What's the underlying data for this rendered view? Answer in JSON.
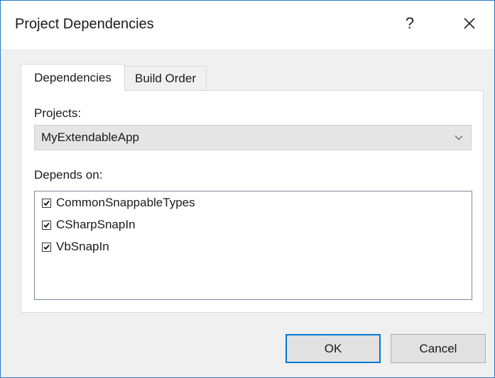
{
  "window": {
    "title": "Project Dependencies",
    "help_label": "?",
    "close_icon": "close-icon"
  },
  "tabs": [
    {
      "label": "Dependencies",
      "selected": true
    },
    {
      "label": "Build Order",
      "selected": false
    }
  ],
  "projects": {
    "label": "Projects:",
    "selected": "MyExtendableApp"
  },
  "depends_on": {
    "label": "Depends on:",
    "items": [
      {
        "label": "CommonSnappableTypes",
        "checked": true
      },
      {
        "label": "CSharpSnapIn",
        "checked": true
      },
      {
        "label": "VbSnapIn",
        "checked": true
      }
    ]
  },
  "buttons": {
    "ok": "OK",
    "cancel": "Cancel"
  },
  "colors": {
    "accent": "#0078d7",
    "window_border": "#2b79c2",
    "dialog_bg": "#f0f0f0"
  }
}
